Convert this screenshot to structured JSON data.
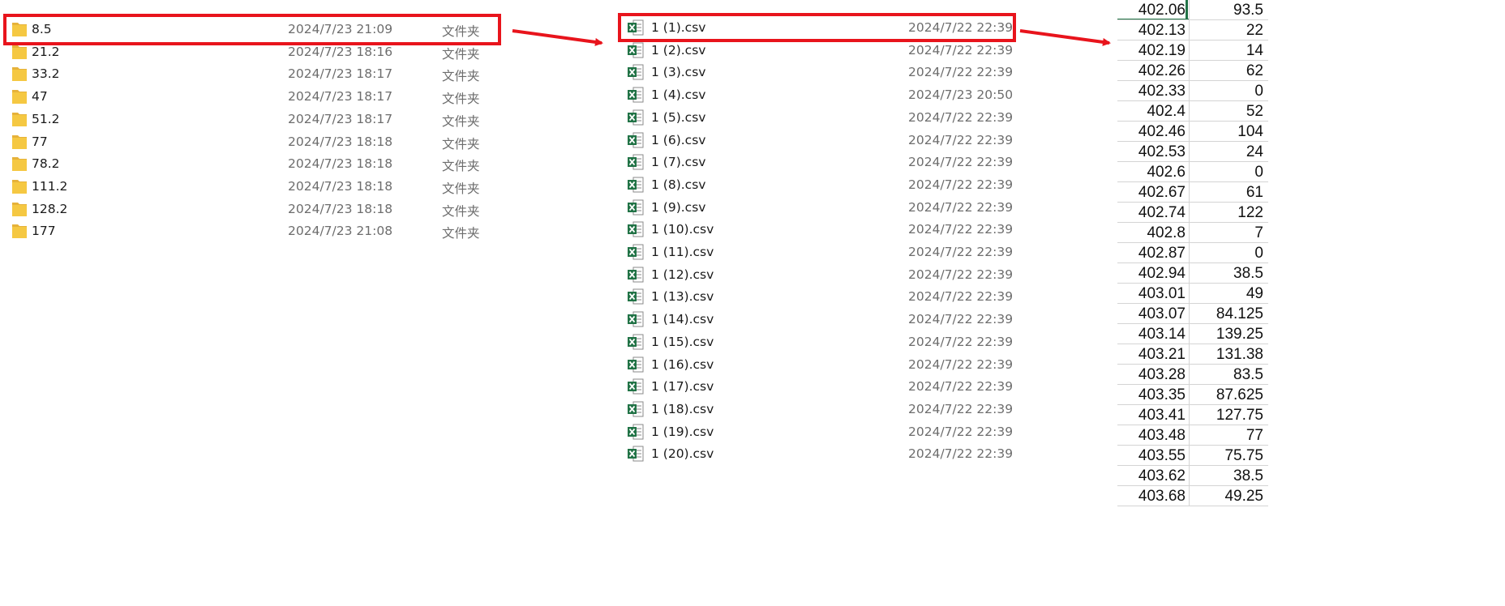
{
  "folders": {
    "type_label": "文件夹",
    "items": [
      {
        "name": "8.5",
        "date": "2024/7/23 21:09"
      },
      {
        "name": "21.2",
        "date": "2024/7/23 18:16"
      },
      {
        "name": "33.2",
        "date": "2024/7/23 18:17"
      },
      {
        "name": "47",
        "date": "2024/7/23 18:17"
      },
      {
        "name": "51.2",
        "date": "2024/7/23 18:17"
      },
      {
        "name": "77",
        "date": "2024/7/23 18:18"
      },
      {
        "name": "78.2",
        "date": "2024/7/23 18:18"
      },
      {
        "name": "111.2",
        "date": "2024/7/23 18:18"
      },
      {
        "name": "128.2",
        "date": "2024/7/23 18:18"
      },
      {
        "name": "177",
        "date": "2024/7/23 21:08"
      }
    ],
    "icon": "folder-icon"
  },
  "files": {
    "icon": "excel-csv-icon",
    "items": [
      {
        "name": "1 (1).csv",
        "date": "2024/7/22 22:39"
      },
      {
        "name": "1 (2).csv",
        "date": "2024/7/22 22:39"
      },
      {
        "name": "1 (3).csv",
        "date": "2024/7/22 22:39"
      },
      {
        "name": "1 (4).csv",
        "date": "2024/7/23 20:50"
      },
      {
        "name": "1 (5).csv",
        "date": "2024/7/22 22:39"
      },
      {
        "name": "1 (6).csv",
        "date": "2024/7/22 22:39"
      },
      {
        "name": "1 (7).csv",
        "date": "2024/7/22 22:39"
      },
      {
        "name": "1 (8).csv",
        "date": "2024/7/22 22:39"
      },
      {
        "name": "1 (9).csv",
        "date": "2024/7/22 22:39"
      },
      {
        "name": "1 (10).csv",
        "date": "2024/7/22 22:39"
      },
      {
        "name": "1 (11).csv",
        "date": "2024/7/22 22:39"
      },
      {
        "name": "1 (12).csv",
        "date": "2024/7/22 22:39"
      },
      {
        "name": "1 (13).csv",
        "date": "2024/7/22 22:39"
      },
      {
        "name": "1 (14).csv",
        "date": "2024/7/22 22:39"
      },
      {
        "name": "1 (15).csv",
        "date": "2024/7/22 22:39"
      },
      {
        "name": "1 (16).csv",
        "date": "2024/7/22 22:39"
      },
      {
        "name": "1 (17).csv",
        "date": "2024/7/22 22:39"
      },
      {
        "name": "1 (18).csv",
        "date": "2024/7/22 22:39"
      },
      {
        "name": "1 (19).csv",
        "date": "2024/7/22 22:39"
      },
      {
        "name": "1 (20).csv",
        "date": "2024/7/22 22:39"
      }
    ]
  },
  "sheet": {
    "rows": [
      [
        "402.06",
        "93.5"
      ],
      [
        "402.13",
        "22"
      ],
      [
        "402.19",
        "14"
      ],
      [
        "402.26",
        "62"
      ],
      [
        "402.33",
        "0"
      ],
      [
        "402.4",
        "52"
      ],
      [
        "402.46",
        "104"
      ],
      [
        "402.53",
        "24"
      ],
      [
        "402.6",
        "0"
      ],
      [
        "402.67",
        "61"
      ],
      [
        "402.74",
        "122"
      ],
      [
        "402.8",
        "7"
      ],
      [
        "402.87",
        "0"
      ],
      [
        "402.94",
        "38.5"
      ],
      [
        "403.01",
        "49"
      ],
      [
        "403.07",
        "84.125"
      ],
      [
        "403.14",
        "139.25"
      ],
      [
        "403.21",
        "131.38"
      ],
      [
        "403.28",
        "83.5"
      ],
      [
        "403.35",
        "87.625"
      ],
      [
        "403.41",
        "127.75"
      ],
      [
        "403.48",
        "77"
      ],
      [
        "403.55",
        "75.75"
      ],
      [
        "403.62",
        "38.5"
      ],
      [
        "403.68",
        "49.25"
      ]
    ]
  },
  "colors": {
    "highlight": "#e8141c",
    "arrow": "#e8141c",
    "excel_green": "#217346",
    "folder_yellow": "#f5c842"
  }
}
